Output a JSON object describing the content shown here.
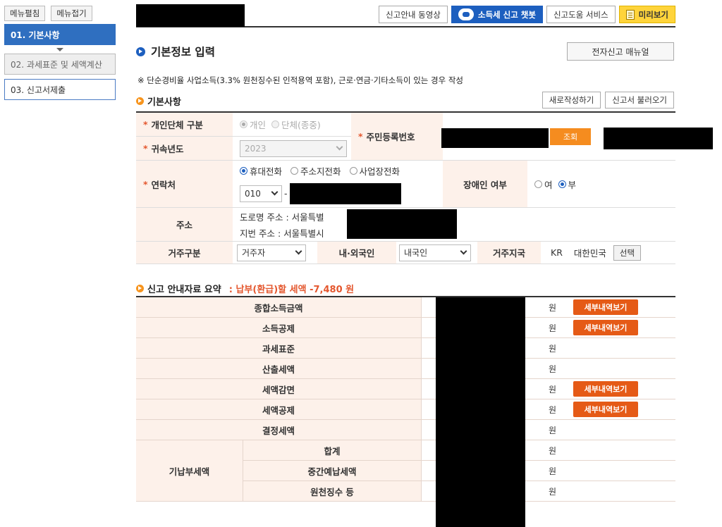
{
  "sidebar": {
    "expand_label": "메뉴펼침",
    "collapse_label": "메뉴접기",
    "steps": [
      {
        "label": "01. 기본사항"
      },
      {
        "label": "02. 과세표준 및 세액계산"
      },
      {
        "label": "03. 신고서제출"
      }
    ]
  },
  "topbar": {
    "video_label": "신고안내 동영상",
    "chatbot_label": "소득세 신고 챗봇",
    "help_label": "신고도움 서비스",
    "preview_label": "미리보기"
  },
  "main": {
    "title": "기본정보 입력",
    "manual_label": "전자신고 매뉴얼",
    "notice": "※ 단순경비율 사업소득(3.3% 원천징수된 인적용역 포함), 근로·연금·기타소득이 있는 경우 작성"
  },
  "basic": {
    "section_title": "기본사항",
    "new_label": "새로작성하기",
    "load_label": "신고서 불러오기",
    "type_label": "개인단체 구분",
    "type_options": [
      "개인",
      "단체(종중)"
    ],
    "year_label": "귀속년도",
    "year_value": "2023",
    "rrn_label": "주민등록번호",
    "lookup_label": "조회",
    "contact_label": "연락처",
    "contact_options": [
      "휴대전화",
      "주소지전화",
      "사업장전화"
    ],
    "phone_prefix": "010",
    "phone_sep": "-",
    "disability_label": "장애인 여부",
    "disability_options": [
      "여",
      "부"
    ],
    "address_label": "주소",
    "road_address": "도로명 주소 :  서울특별",
    "lot_address": "지번 주소 :  서울특별시",
    "residence_label": "거주구분",
    "residence_value": "거주자",
    "nationality_label": "내·외국인",
    "nationality_value": "내국인",
    "country_label": "거주지국",
    "country_code": "KR",
    "country_name": "대한민국",
    "choose_label": "선택"
  },
  "summary": {
    "section_title": "신고 안내자료 요약",
    "tax_text": ": 납부(환급)할 세액 -7,480 원",
    "unit": "원",
    "detail_label": "세부내역보기",
    "rows": [
      {
        "label": "종합소득금액"
      },
      {
        "label": "소득공제"
      },
      {
        "label": "과세표준"
      },
      {
        "label": "산출세액"
      },
      {
        "label": "세액감면"
      },
      {
        "label": "세액공제"
      },
      {
        "label": "결정세액"
      }
    ],
    "prepaid_label": "기납부세액",
    "prepaid_rows": [
      {
        "label": "합계"
      },
      {
        "label": "중간예납세액"
      },
      {
        "label": "원천징수 등"
      }
    ]
  }
}
